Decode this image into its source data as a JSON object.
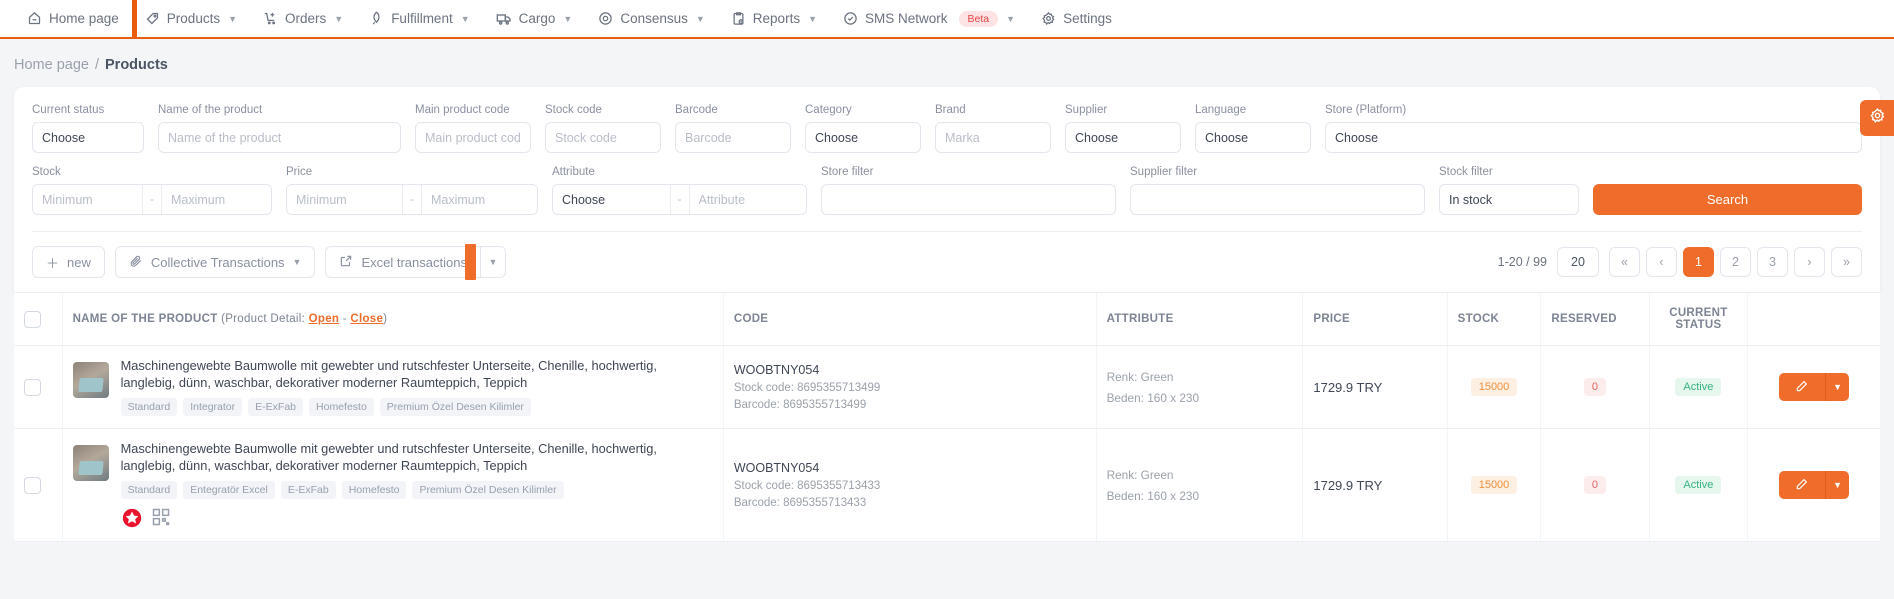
{
  "nav": {
    "items": [
      {
        "label": "Home page",
        "icon": "home-icon",
        "caret": false,
        "active": false
      },
      {
        "label": "Products",
        "icon": "tag-icon",
        "caret": true,
        "active": true
      },
      {
        "label": "Orders",
        "icon": "cart-icon",
        "caret": true,
        "active": false
      },
      {
        "label": "Fulfillment",
        "icon": "rocket-icon",
        "caret": true,
        "active": false
      },
      {
        "label": "Cargo",
        "icon": "truck-icon",
        "caret": true,
        "active": false
      },
      {
        "label": "Consensus",
        "icon": "target-icon",
        "caret": true,
        "active": false
      },
      {
        "label": "Reports",
        "icon": "clipboard-icon",
        "caret": true,
        "active": false
      },
      {
        "label": "SMS Network",
        "icon": "check-circle-icon",
        "caret": true,
        "active": false,
        "badge": "Beta"
      },
      {
        "label": "Settings",
        "icon": "gear-icon",
        "caret": false,
        "active": false
      }
    ]
  },
  "breadcrumb": {
    "home": "Home page",
    "separator": "/",
    "current": "Products"
  },
  "filters": {
    "row1": [
      {
        "label": "Current status",
        "value": "Choose",
        "type": "select"
      },
      {
        "label": "Name of the product",
        "placeholder": "Name of the product",
        "type": "text"
      },
      {
        "label": "Main product code",
        "placeholder": "Main product code",
        "type": "text"
      },
      {
        "label": "Stock code",
        "placeholder": "Stock code",
        "type": "text"
      },
      {
        "label": "Barcode",
        "placeholder": "Barcode",
        "type": "text"
      },
      {
        "label": "Category",
        "value": "Choose",
        "type": "select"
      },
      {
        "label": "Brand",
        "placeholder": "Marka",
        "type": "text"
      },
      {
        "label": "Supplier",
        "value": "Choose",
        "type": "select"
      },
      {
        "label": "Language",
        "value": "Choose",
        "type": "select"
      },
      {
        "label": "Store (Platform)",
        "value": "Choose",
        "type": "select"
      }
    ],
    "stock": {
      "label": "Stock",
      "min_placeholder": "Minimum",
      "max_placeholder": "Maximum",
      "dash": "-"
    },
    "price": {
      "label": "Price",
      "min_placeholder": "Minimum",
      "max_placeholder": "Maximum",
      "dash": "-"
    },
    "attribute": {
      "label": "Attribute",
      "value": "Choose",
      "placeholder": "Attribute",
      "dash": "-"
    },
    "store_filter": {
      "label": "Store filter",
      "value": ""
    },
    "supplier_filter": {
      "label": "Supplier filter",
      "value": ""
    },
    "stock_filter": {
      "label": "Stock filter",
      "value": "In stock"
    },
    "search_button": "Search"
  },
  "toolbar": {
    "new_label": "new",
    "collective_label": "Collective Transactions",
    "excel_label": "Excel transactions",
    "range_text": "1-20 / 99",
    "per_page": "20",
    "pages": [
      "1",
      "2",
      "3"
    ],
    "current_page": "1",
    "first_label": "«",
    "prev_label": "‹",
    "next_label": "›",
    "last_label": "»"
  },
  "table": {
    "headers": {
      "name_prefix": "NAME OF THE PRODUCT",
      "name_suffix_open": "(Product Detail: ",
      "link_open": "Open",
      "link_dash": " - ",
      "link_close": "Close",
      "name_suffix_end": ")",
      "code": "CODE",
      "attribute": "ATTRIBUTE",
      "price": "PRICE",
      "stock": "STOCK",
      "reserved": "RESERVED",
      "current_status": "CURRENT STATUS"
    },
    "rows": [
      {
        "title": "Maschinengewebte Baumwolle mit gewebter und rutschfester Unterseite, Chenille, hochwertig, langlebig, dünn, waschbar, dekorativer moderner Raumteppich, Teppich",
        "tags": [
          "Standard",
          "Integrator",
          "E-ExFab",
          "Homefesto",
          "Premium Özel Desen Kilimler"
        ],
        "code": "WOOBTNY054",
        "stock_code": "Stock code: 8695355713499",
        "barcode": "Barcode: 8695355713499",
        "attr1": "Renk: Green",
        "attr2": "Beden: 160 x 230",
        "price": "1729.9 TRY",
        "stock": "15000",
        "reserved": "0",
        "status": "Active",
        "has_icons": false
      },
      {
        "title": "Maschinengewebte Baumwolle mit gewebter und rutschfester Unterseite, Chenille, hochwertig, langlebig, dünn, waschbar, dekorativer moderner Raumteppich, Teppich",
        "tags": [
          "Standard",
          "Entegratör Excel",
          "E-ExFab",
          "Homefesto",
          "Premium Özel Desen Kilimler"
        ],
        "code": "WOOBTNY054",
        "stock_code": "Stock code: 8695355713433",
        "barcode": "Barcode: 8695355713433",
        "attr1": "Renk: Green",
        "attr2": "Beden: 160 x 230",
        "price": "1729.9 TRY",
        "stock": "15000",
        "reserved": "0",
        "status": "Active",
        "has_icons": true
      }
    ]
  },
  "fab": {
    "name": "settings-fab",
    "icon": "gear-icon"
  },
  "colors": {
    "accent": "#ef6c2b",
    "nav_border": "#ea5b0c",
    "green": "#36b37e",
    "red": "#e8635f"
  }
}
